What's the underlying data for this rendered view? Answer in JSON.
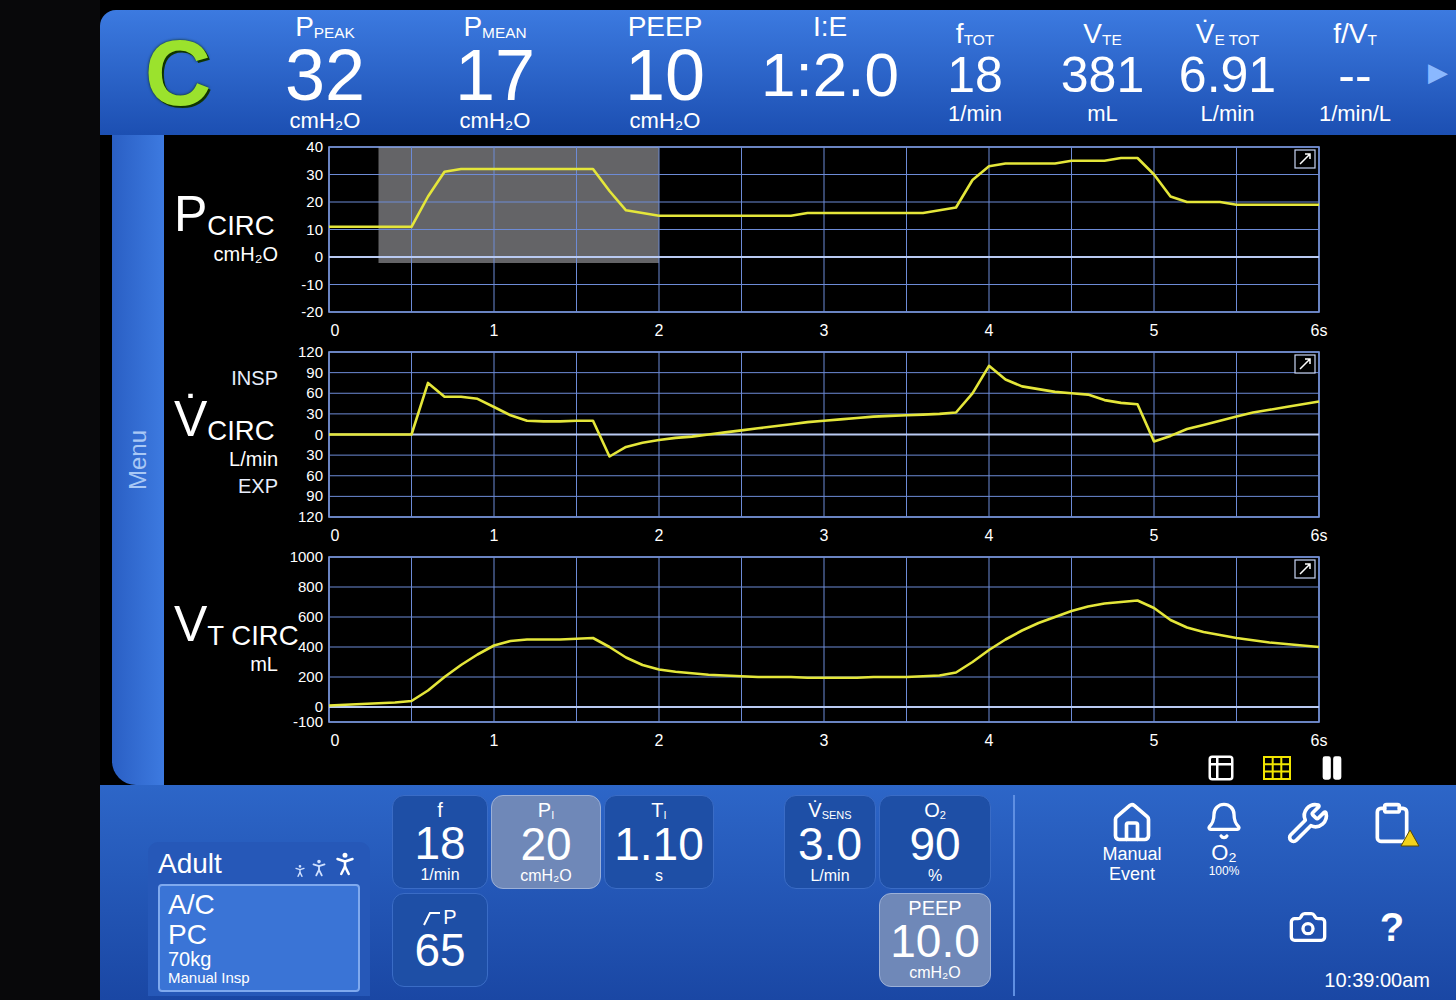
{
  "status_badge": {
    "label": "C"
  },
  "readings": [
    {
      "label": "P",
      "sub": "PEAK",
      "value": "32",
      "unit": "cmH₂O",
      "kind": "large"
    },
    {
      "label": "P",
      "sub": "MEAN",
      "value": "17",
      "unit": "cmH₂O",
      "kind": "large"
    },
    {
      "label": "PEEP",
      "sub": "",
      "value": "10",
      "unit": "cmH₂O",
      "kind": "large"
    },
    {
      "label": "I:E",
      "sub": "",
      "value": "1:2.0",
      "unit": "",
      "kind": "medium"
    },
    {
      "label": "f",
      "sub": "TOT",
      "value": "18",
      "unit": "1/min",
      "kind": "small"
    },
    {
      "label": "V",
      "sub": "TE",
      "value": "381",
      "unit": "mL",
      "kind": "small"
    },
    {
      "label": "V̇",
      "sub": "E TOT",
      "value": "6.91",
      "unit": "L/min",
      "kind": "small"
    },
    {
      "label": "f/V",
      "sub": "T",
      "value": "--",
      "unit": "1/min/L",
      "kind": "small"
    }
  ],
  "readings_more": "▶",
  "menu_tab": {
    "label": "Menu"
  },
  "charts": [
    {
      "label": "P",
      "sub": "CIRC",
      "unit": "cmH₂O",
      "top_note": "",
      "bottom_note": "",
      "y_range": {
        "max": 40,
        "min": -20
      },
      "y_ticks": [
        {
          "label": "40",
          "value": 40
        },
        {
          "label": "30",
          "value": 30
        },
        {
          "label": "20",
          "value": 20
        },
        {
          "label": "10",
          "value": 10
        },
        {
          "label": "0",
          "value": 0
        },
        {
          "label": "-10",
          "value": -10
        },
        {
          "label": "-20",
          "value": -20
        }
      ],
      "x_ticks": [
        "0",
        "1",
        "2",
        "3",
        "4",
        "5",
        "6s"
      ],
      "highlight": [
        0.3,
        2.0
      ],
      "values": [
        11,
        11,
        11,
        11,
        11,
        11,
        22,
        31,
        32,
        32,
        32,
        32,
        32,
        32,
        32,
        32,
        32,
        24,
        17,
        16,
        15,
        15,
        15,
        15,
        15,
        15,
        15,
        15,
        15,
        16,
        16,
        16,
        16,
        16,
        16,
        16,
        16,
        17,
        18,
        28,
        33,
        34,
        34,
        34,
        34,
        35,
        35,
        35,
        36,
        36,
        30,
        22,
        20,
        20,
        20,
        19,
        19,
        19,
        19,
        19,
        19
      ]
    },
    {
      "label": "V̇",
      "sub": "CIRC",
      "unit": "L/min",
      "top_note": "INSP",
      "bottom_note": "EXP",
      "y_range": {
        "max": 120,
        "min": -120
      },
      "y_ticks": [
        {
          "label": "120",
          "value": 120
        },
        {
          "label": "90",
          "value": 90
        },
        {
          "label": "60",
          "value": 60
        },
        {
          "label": "30",
          "value": 30
        },
        {
          "label": "0",
          "value": 0
        },
        {
          "label": "30",
          "value": -30
        },
        {
          "label": "60",
          "value": -60
        },
        {
          "label": "90",
          "value": -90
        },
        {
          "label": "120",
          "value": -120
        }
      ],
      "x_ticks": [
        "0",
        "1",
        "2",
        "3",
        "4",
        "5",
        "6s"
      ],
      "highlight": [],
      "values": [
        0,
        0,
        0,
        0,
        0,
        0,
        75,
        55,
        55,
        52,
        40,
        28,
        20,
        19,
        19,
        20,
        20,
        -32,
        -18,
        -12,
        -8,
        -5,
        -3,
        0,
        3,
        6,
        9,
        12,
        15,
        18,
        20,
        22,
        24,
        26,
        27,
        28,
        29,
        30,
        32,
        60,
        100,
        80,
        70,
        66,
        62,
        60,
        58,
        50,
        46,
        44,
        -10,
        -2,
        8,
        14,
        20,
        26,
        32,
        36,
        40,
        44,
        48
      ]
    },
    {
      "label": "V",
      "sub": "T CIRC",
      "unit": "mL",
      "top_note": "",
      "bottom_note": "",
      "y_range": {
        "max": 1000,
        "min": -100
      },
      "y_ticks": [
        {
          "label": "1000",
          "value": 1000
        },
        {
          "label": "800",
          "value": 800
        },
        {
          "label": "600",
          "value": 600
        },
        {
          "label": "400",
          "value": 400
        },
        {
          "label": "200",
          "value": 200
        },
        {
          "label": "0",
          "value": 0
        },
        {
          "label": "-100",
          "value": -100
        }
      ],
      "x_ticks": [
        "0",
        "1",
        "2",
        "3",
        "4",
        "5",
        "6s"
      ],
      "highlight": [],
      "values": [
        10,
        15,
        20,
        25,
        30,
        40,
        110,
        200,
        280,
        350,
        410,
        440,
        450,
        450,
        450,
        455,
        460,
        400,
        330,
        280,
        250,
        235,
        225,
        215,
        210,
        205,
        200,
        200,
        200,
        195,
        195,
        195,
        195,
        200,
        200,
        200,
        205,
        210,
        230,
        300,
        380,
        450,
        510,
        560,
        600,
        640,
        670,
        690,
        700,
        710,
        660,
        580,
        530,
        500,
        480,
        460,
        445,
        430,
        420,
        410,
        400
      ]
    }
  ],
  "view_controls": [
    {
      "selected": false
    },
    {
      "selected": true
    },
    {
      "selected": false
    }
  ],
  "patient": {
    "category": "Adult",
    "mode": "A/C",
    "type": "PC",
    "weight": "70kg",
    "option": "Manual Insp"
  },
  "settings": [
    {
      "label": "f",
      "sub": "",
      "value": "18",
      "unit": "1/min",
      "selected": false,
      "kind": "plain"
    },
    {
      "label": "P",
      "sub": "I",
      "value": "20",
      "unit": "cmH₂O",
      "selected": true,
      "kind": "plain"
    },
    {
      "label": "T",
      "sub": "I",
      "value": "1.10",
      "unit": "s",
      "selected": false,
      "kind": "plain"
    },
    {
      "label": "V̇",
      "sub": "SENS",
      "value": "3.0",
      "unit": "L/min",
      "selected": false,
      "kind": "plain"
    },
    {
      "label": "O",
      "sub": "2",
      "value": "90",
      "unit": "%",
      "selected": false,
      "kind": "plain"
    },
    {
      "label": "P",
      "sub": "",
      "value": "65",
      "unit": "",
      "selected": false,
      "kind": "rise"
    },
    {
      "label": "PEEP",
      "sub": "",
      "value": "10.0",
      "unit": "cmH₂O",
      "selected": true,
      "kind": "plain"
    }
  ],
  "shortcuts": [
    {
      "label": "Manual Event",
      "detail": ""
    },
    {
      "label": "O₂",
      "detail": "100%"
    }
  ],
  "tools": {
    "log_alert": true,
    "help": "?"
  },
  "clock": "10:39:00am"
}
